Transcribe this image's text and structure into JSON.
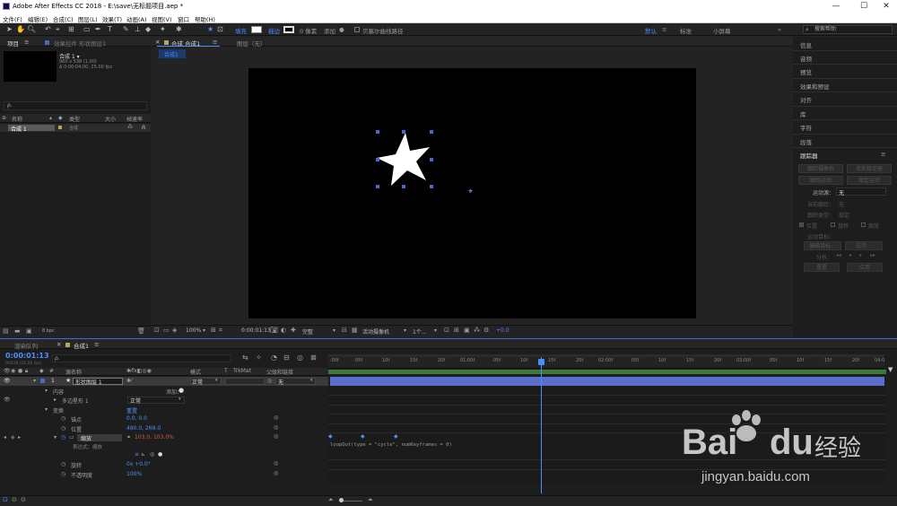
{
  "window": {
    "title": "Adobe After Effects CC 2018 - E:\\save\\无标题项目.aep *",
    "min": "—",
    "max": "☐",
    "close": "✕"
  },
  "menu": [
    "文件(F)",
    "编辑(E)",
    "合成(C)",
    "图层(L)",
    "效果(T)",
    "动画(A)",
    "视图(V)",
    "窗口",
    "帮助(H)"
  ],
  "toolbar": {
    "fill_label": "填充",
    "stroke_label": "描边",
    "pixels": "0 像素",
    "add": "添加",
    "bezier": "贝塞尔曲线路径",
    "workspaces": [
      "默认",
      "标准",
      "小屏幕"
    ],
    "more": "»",
    "search_placeholder": "搜索帮助"
  },
  "project": {
    "tab": "项目",
    "tab_menu": "≡",
    "effects_tab": "效果控件 形状图层1",
    "comp_name": "合成 1 ▾",
    "comp_info1": "960 x 538 (1.00)",
    "comp_info2": "Δ 0:00:04:00, 25.00 fps",
    "search_placeholder": "ρ.",
    "cols": [
      "名称",
      "类型",
      "大小",
      "帧速率"
    ],
    "row": {
      "name": "合成 1",
      "type": "合成"
    },
    "footer": "8 bpc"
  },
  "comp": {
    "tab": "合成 合成1",
    "tab_menu": "≡",
    "layer_tab": "图层（无）",
    "breadcrumb": "合成1",
    "zoom": "100%",
    "time": "0:00:01:13",
    "quality": "完整",
    "camera": "活动摄像机",
    "views": "1个...",
    "offset": "+0.0"
  },
  "right": {
    "items": [
      "信息",
      "音频",
      "预览",
      "效果和预设",
      "对齐",
      "库",
      "字符",
      "段落"
    ],
    "tracker": "跟踪器",
    "tracker_menu": "≡",
    "btns": [
      "跟踪摄像机",
      "变形稳定器",
      "跟踪运动",
      "稳定运动"
    ],
    "motion_source_label": "运动源：",
    "motion_source": "无",
    "current_track_label": "当前跟踪：",
    "current_track": "无",
    "track_type_label": "跟踪类型：",
    "track_type": "稳定",
    "checks": [
      "位置",
      "旋转",
      "缩放"
    ],
    "motion_target": "运动目标：",
    "edit_target": "编辑目标...",
    "options": "选项...",
    "analyze": "分析：",
    "reset": "重置",
    "apply": "应用"
  },
  "timeline": {
    "render_tab": "渲染队列",
    "comp_tab": "合成1",
    "tab_menu": "≡",
    "time": "0:00:01:13",
    "frames": "00038 (25.00 fps)",
    "search_placeholder": "ρ.",
    "cols": {
      "source": "源名称",
      "mode": "模式",
      "trkmat": "TrkMat",
      "parent": "父级和链接"
    },
    "layer": {
      "num": "1",
      "name": "形状图层 1",
      "mode": "正常",
      "parent": "无"
    },
    "props": {
      "contents": "内容",
      "add": "添加：",
      "polystar": "多边星形 1",
      "polystar_mode": "正常",
      "transform": "变换",
      "reset": "重置",
      "anchor": "锚点",
      "anchor_val": "0.0, 0.0",
      "position": "位置",
      "position_val": "480.0, 269.0",
      "scale": "缩放",
      "scale_val": "103.0, 103.0%",
      "expr_label": "表达式：缩放",
      "rotation": "旋转",
      "rotation_val": "0x +0.0°",
      "opacity": "不透明度",
      "opacity_val": "100%"
    },
    "ruler": [
      ":00f",
      "05f",
      "10f",
      "15f",
      "20f",
      "01:00f",
      "05f",
      "10f",
      "15f",
      "20f",
      "02:00f",
      "05f",
      "10f",
      "15f",
      "20f",
      "03:00f",
      "05f",
      "10f",
      "15f",
      "20f",
      "04:0"
    ],
    "expression": "loopOut(type = \"cycle\", numKeyframes = 0)"
  },
  "watermark": {
    "brand": "Bai",
    "brand2": "du",
    "cn": "经验",
    "url": "jingyan.baidu.com"
  }
}
